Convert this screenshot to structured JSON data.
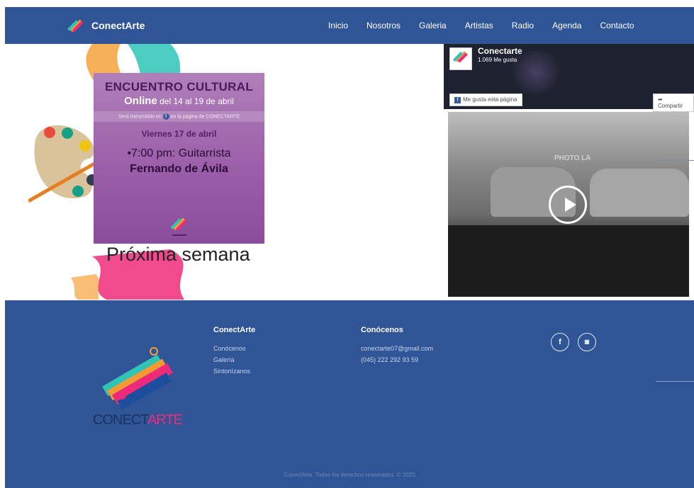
{
  "nav": {
    "brand": "ConectArte",
    "items": [
      "Inicio",
      "Nosotros",
      "Galeria",
      "Artistas",
      "Radio",
      "Agenda",
      "Contacto"
    ]
  },
  "poster": {
    "title": "ENCUENTRO CULTURAL",
    "online_bold": "Online",
    "online_rest": "del 14 al 19 de abril",
    "strip_pre": "Será transmitido en",
    "strip_fb": "f",
    "strip_post": "en la página de CONECTARTE",
    "day": "Viernes 17 de abril",
    "time": "•7:00 pm: Guitarrista",
    "name": "Fernando de Ávila"
  },
  "next_week": "Próxima semana",
  "facebook": {
    "page_name": "Conectarte",
    "likes": "1.069 Me gusta",
    "like_button": "Me gusta esta página",
    "share_button": "Compartir"
  },
  "footer": {
    "col1": {
      "title": "ConectArte",
      "links": [
        "Conócenos",
        "Galería",
        "Sintonízanos"
      ]
    },
    "col2": {
      "title": "Conócenos",
      "email": "conectarte07@gmail.com",
      "phone": "(045) 222 292 93 59"
    },
    "logo_text_a": "CONECT",
    "logo_text_b": "ARTE",
    "copyright": "ConectArte. Todos los derechos reservados. © 2020",
    "social_icons": [
      "facebook-icon",
      "instagram-icon"
    ]
  },
  "colors": {
    "nav": "#2f5597",
    "footer": "#2f5597",
    "accent_pink": "#ee2b7a"
  }
}
